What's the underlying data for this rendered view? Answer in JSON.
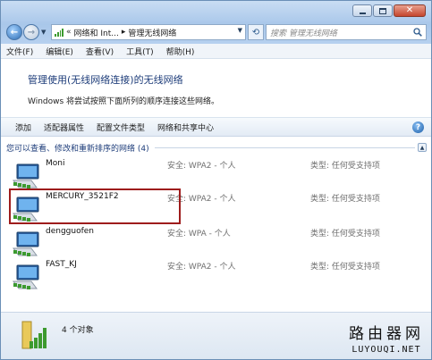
{
  "window": {
    "controls": [
      "minimize-icon",
      "maximize-icon",
      "close-icon"
    ]
  },
  "nav": {
    "address_sep": "«",
    "address_part1": "网络和 Int...",
    "address_arrow": "▸",
    "address_part2": "管理无线网络",
    "search_placeholder": "搜索 管理无线网络"
  },
  "menu": {
    "items": [
      "文件(F)",
      "编辑(E)",
      "查看(V)",
      "工具(T)",
      "帮助(H)"
    ]
  },
  "header": {
    "title": "管理使用(无线网络连接)的无线网络",
    "description": "Windows 将尝试按照下面所列的顺序连接这些网络。"
  },
  "toolbar": {
    "items": [
      "添加",
      "适配器属性",
      "配置文件类型",
      "网络和共享中心"
    ]
  },
  "group": {
    "label": "您可以查看、修改和重新排序的网络 (4)"
  },
  "networks": [
    {
      "name": "Moni",
      "security": "安全: WPA2 - 个人",
      "type": "类型: 任何受支持项"
    },
    {
      "name": "MERCURY_3521F2",
      "security": "安全: WPA2 - 个人",
      "type": "类型: 任何受支持项"
    },
    {
      "name": "dengguofen",
      "security": "安全: WPA - 个人",
      "type": "类型: 任何受支持项"
    },
    {
      "name": "FAST_KJ",
      "security": "安全: WPA2 - 个人",
      "type": "类型: 任何受支持项"
    }
  ],
  "status": {
    "count": "4 个对象"
  },
  "watermark": {
    "cn": "路由器网",
    "en": "LUYOUQI.NET"
  },
  "colors": {
    "accent": "#1e3d7a",
    "highlight": "#9e1c1c",
    "signal": "#3c9a2f"
  }
}
